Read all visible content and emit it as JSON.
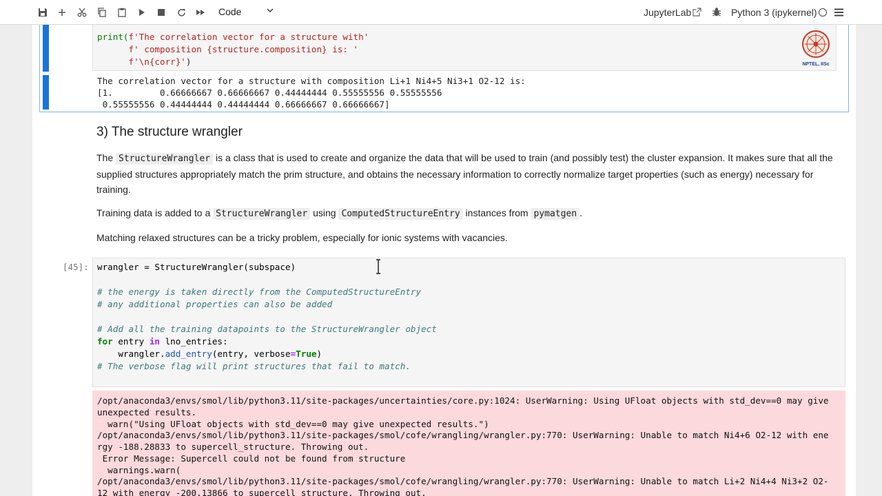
{
  "toolbar": {
    "cell_type": "Code",
    "app_name": "JupyterLab",
    "kernel_name": "Python 3 (ipykernel)"
  },
  "top_cell": {
    "code": [
      [
        "print(",
        "f'The correlation vector for a structure with'"
      ],
      [
        "      ",
        "f' composition {structure.composition} is: '"
      ],
      [
        "      ",
        "f'\\n{corr}'",
        ")"
      ]
    ],
    "output": [
      "The correlation vector for a structure with composition Li+1 Ni4+5 Ni3+1 O2-12 is:",
      "[1.         0.66666667 0.66666667 0.44444444 0.55555556 0.55555556",
      " 0.55555556 0.44444444 0.44444444 0.66666667 0.66666667]"
    ],
    "logo_text": "NPTEL, IISc"
  },
  "markdown": {
    "heading": "3) The structure wrangler",
    "p1_a": "The ",
    "p1_code": "StructureWrangler",
    "p1_b": " is a class that is used to create and organize the data that will be used to train (and possibly test) the cluster expansion. It makes sure that all the supplied structures appropriately match the prim structure, and obtains the necessary information to correctly normalize target properties (such as energy) necessary for training.",
    "p2_a": "Training data is added to a ",
    "p2_code1": "StructureWrangler",
    "p2_b": " using ",
    "p2_code2": "ComputedStructureEntry",
    "p2_c": " instances from ",
    "p2_code3": "pymatgen",
    "p2_d": ".",
    "p3": "Matching relaxed structures can be a tricky problem, especially for ionic systems with vacancies."
  },
  "code_cell": {
    "prompt": "[45]:",
    "line1": "wrangler = StructureWrangler(subspace)",
    "comment1": "# the energy is taken directly from the ComputedStructureEntry",
    "comment2": "# any additional properties can also be added",
    "comment3": "# Add all the training datapoints to the StructureWrangler object",
    "for_kw": "for",
    "for_var": " entry ",
    "in_kw": "in",
    "for_rest": " lno_entries:",
    "call_indent": "    wrangler.",
    "call_fn": "add_entry",
    "call_args": "(entry, verbose",
    "call_eq": "=",
    "call_true": "True",
    "call_close": ")",
    "comment4": "# The verbose flag will print structures that fail to match."
  },
  "stderr": [
    "/opt/anaconda3/envs/smol/lib/python3.11/site-packages/uncertainties/core.py:1024: UserWarning: Using UFloat objects with std_dev==0 may give",
    "unexpected results.",
    "  warn(\"Using UFloat objects with std_dev==0 may give unexpected results.\")",
    "/opt/anaconda3/envs/smol/lib/python3.11/site-packages/smol/cofe/wrangling/wrangler.py:770: UserWarning: Unable to match Ni4+6 O2-12 with ene",
    "rgy -188.28833 to supercell_structure. Throwing out.",
    " Error Message: Supercell could not be found from structure",
    "  warnings.warn(",
    "/opt/anaconda3/envs/smol/lib/python3.11/site-packages/smol/cofe/wrangling/wrangler.py:770: UserWarning: Unable to match Li+2 Ni4+4 Ni3+2 O2-",
    "12 with energy -200.13866 to supercell_structure. Throwing out."
  ]
}
